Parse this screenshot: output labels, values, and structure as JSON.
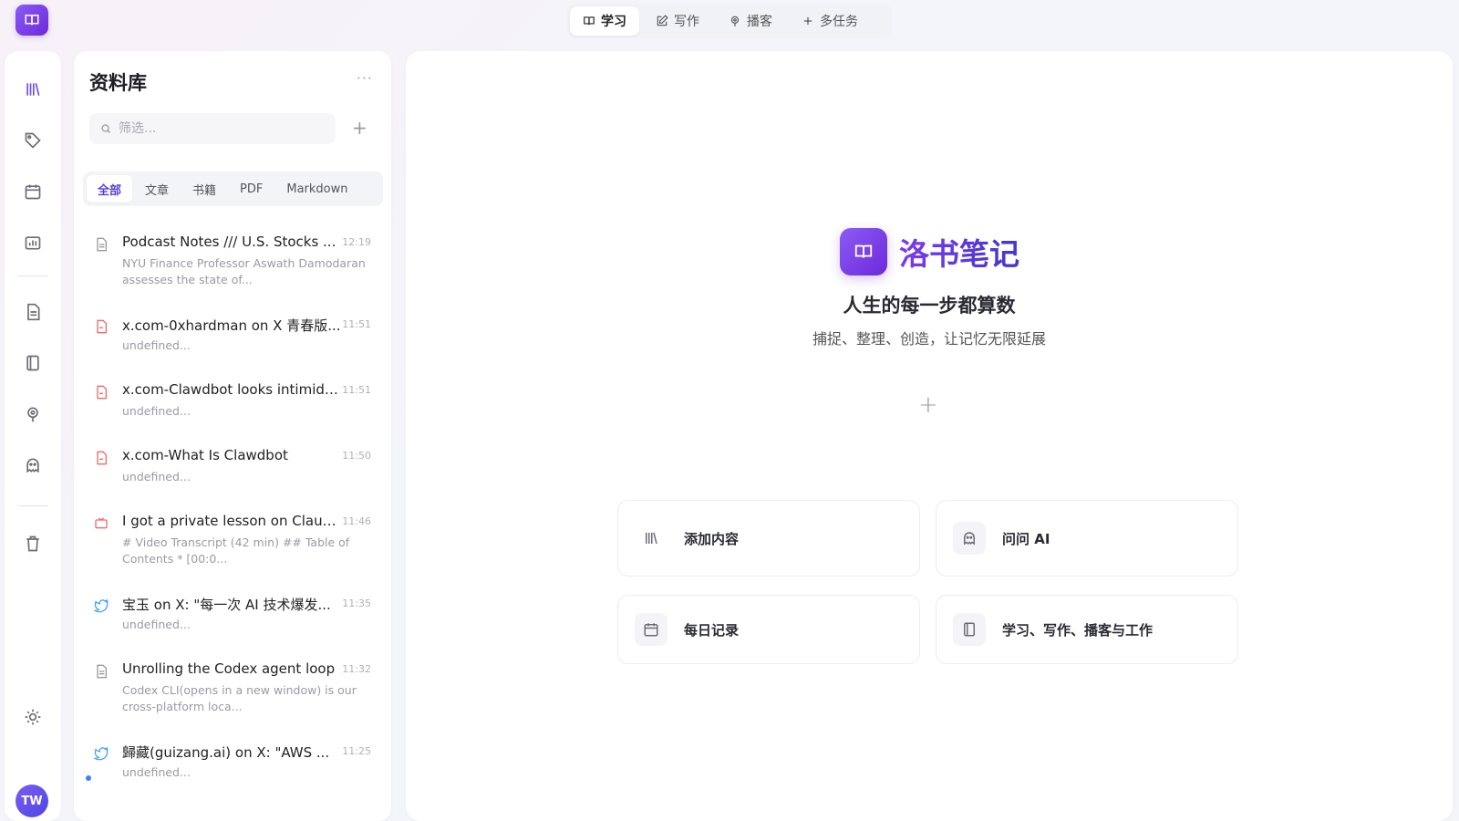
{
  "topnav": {
    "tabs": [
      {
        "label": "学习",
        "icon": "book-icon",
        "active": true
      },
      {
        "label": "写作",
        "icon": "edit-icon",
        "active": false
      },
      {
        "label": "播客",
        "icon": "podcast-icon",
        "active": false
      },
      {
        "label": "多任务",
        "icon": "plus-icon",
        "active": false
      }
    ]
  },
  "sidebar": {
    "avatar_initials": "TW",
    "icons": [
      "library-icon",
      "tag-icon",
      "calendar-icon",
      "folder-chart-icon",
      "document-icon",
      "notebook-icon",
      "podcast-icon",
      "ai-assistant-icon",
      "trash-icon",
      "theme-icon"
    ]
  },
  "library": {
    "title": "资料库",
    "more": "···",
    "search_placeholder": "筛选...",
    "add": "+",
    "filters": [
      "全部",
      "文章",
      "书籍",
      "PDF",
      "Markdown"
    ],
    "items": [
      {
        "type": "document",
        "title": "Podcast Notes /// U.S. Stocks ...",
        "time": "12:19",
        "desc": "NYU Finance Professor Aswath Damodaran assesses the state of..."
      },
      {
        "type": "pdf",
        "title": "x.com-0xhardman on X 青春版...",
        "time": "11:51",
        "desc": "undefined..."
      },
      {
        "type": "pdf",
        "title": "x.com-Clawdbot looks intimida...",
        "time": "11:51",
        "desc": "undefined..."
      },
      {
        "type": "pdf",
        "title": "x.com-What Is Clawdbot",
        "time": "11:50",
        "desc": "undefined..."
      },
      {
        "type": "video",
        "title": "I got a private lesson on Claud...",
        "time": "11:46",
        "desc": "# Video Transcript (42 min) ## Table of Contents * [00:0..."
      },
      {
        "type": "twitter",
        "title": "宝玉 on X: \"每一次 AI 技术爆发...",
        "time": "11:35",
        "desc": "undefined..."
      },
      {
        "type": "document",
        "title": "Unrolling the Codex agent loop",
        "time": "11:32",
        "desc": "Codex CLI(opens in a new window) is our cross-platform loca..."
      },
      {
        "type": "twitter",
        "title": "歸藏(guizang.ai) on X: \"AWS ...",
        "time": "11:25",
        "desc": "undefined...",
        "unread": true
      }
    ]
  },
  "hero": {
    "name": "洛书笔记",
    "tagline": "人生的每一步都算数",
    "subtitle": "捕捉、整理、创造，让记忆无限延展",
    "plus": "+"
  },
  "cards": [
    {
      "label": "添加内容",
      "icon": "library-icon"
    },
    {
      "label": "问问 AI",
      "icon": "ai-assistant-icon"
    },
    {
      "label": "每日记录",
      "icon": "calendar-icon"
    },
    {
      "label": "学习、写作、播客与工作",
      "icon": "notebook-icon"
    }
  ],
  "colors": {
    "accent": "#6d4fe0",
    "brand_gradient_start": "#8b5cf6",
    "brand_gradient_end": "#6d28d9"
  }
}
